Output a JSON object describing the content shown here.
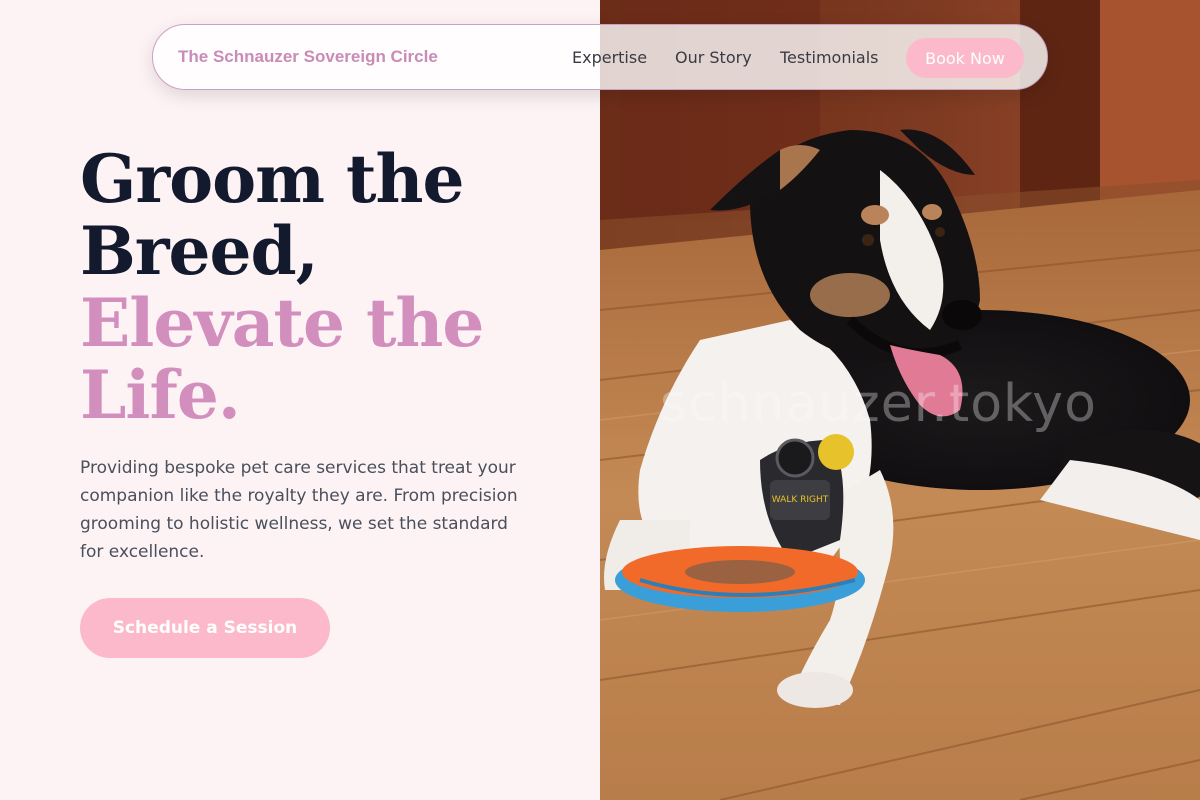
{
  "nav": {
    "brand": "The Schnauzer Sovereign Circle",
    "links": [
      "Expertise",
      "Our Story",
      "Testimonials"
    ],
    "cta": "Book Now"
  },
  "hero": {
    "headline_line1": "Groom the",
    "headline_line2": "Breed,",
    "headline_accent_line1": "Elevate the",
    "headline_accent_line2": "Life.",
    "description": "Providing bespoke pet care services that treat your companion like the royalty they are. From precision grooming to holistic wellness, we set the standard for excellence.",
    "cta": "Schedule a Session"
  },
  "image": {
    "watermark": "schnauzer.tokyo",
    "harness_label": "WALK RIGHT"
  },
  "colors": {
    "accent_pink": "#d28fbd",
    "button_pink": "#fdb9cc",
    "headline_dark": "#131a2e",
    "background": "#fdf3f5"
  }
}
